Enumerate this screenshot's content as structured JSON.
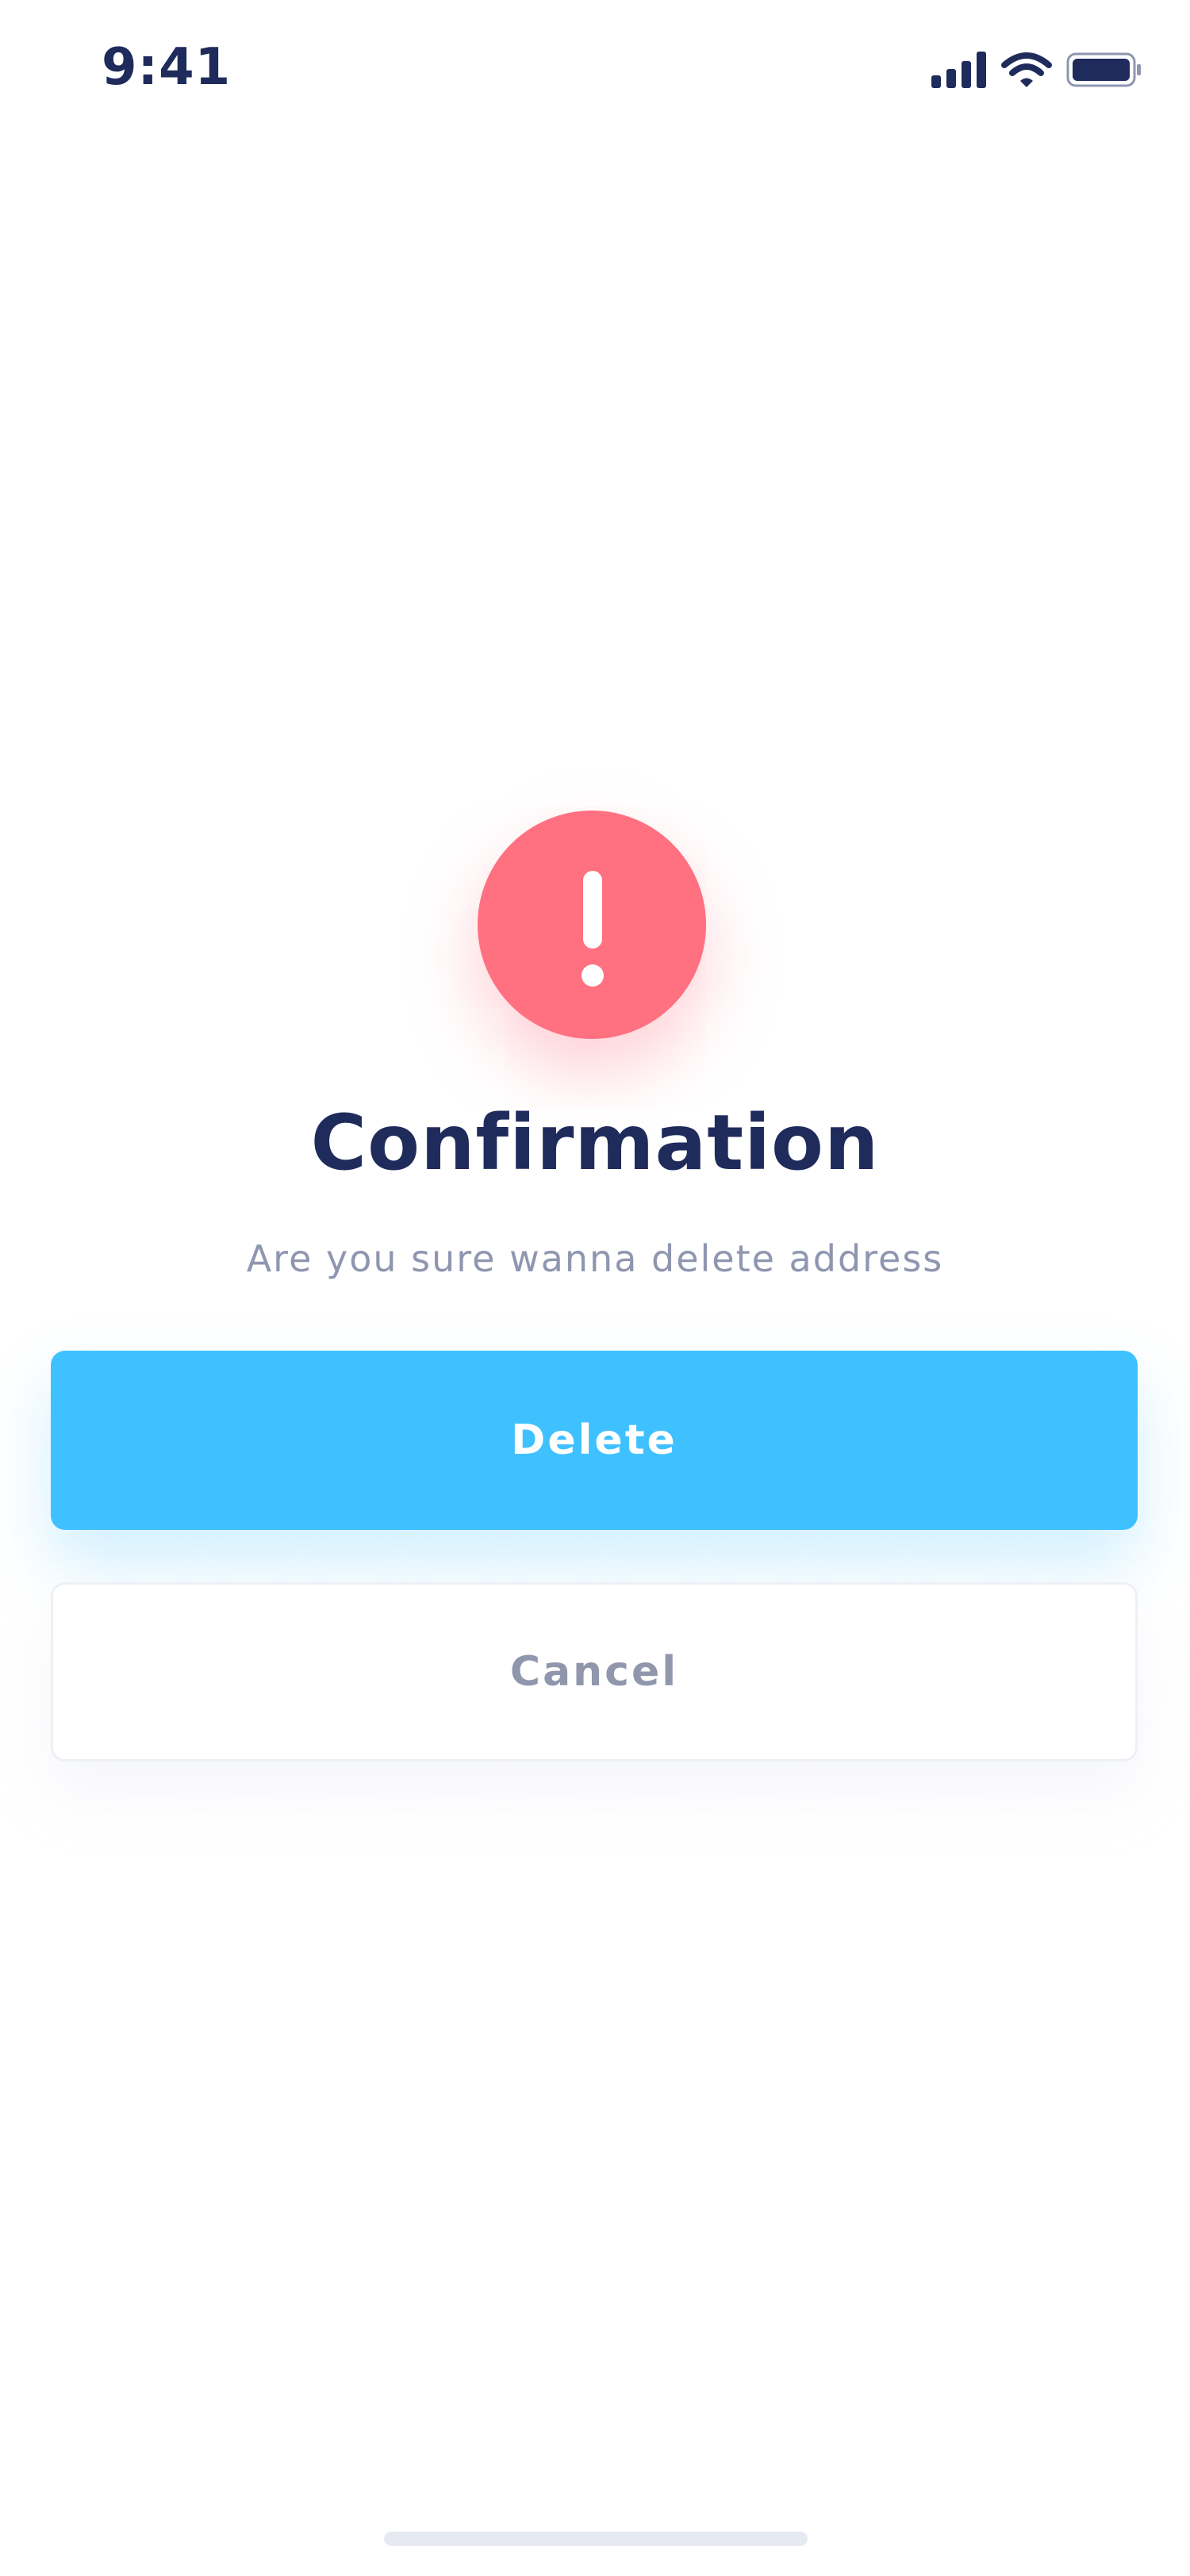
{
  "status_bar": {
    "time": "9:41",
    "icons": [
      "signal-icon",
      "wifi-icon",
      "battery-icon"
    ]
  },
  "dialog": {
    "icon": "exclamation-icon",
    "title": "Confirmation",
    "message": "Are you sure wanna delete address",
    "delete_label": "Delete",
    "cancel_label": "Cancel"
  },
  "colors": {
    "primary": "#40c1ff",
    "danger": "#ff7080",
    "title": "#1f2b5b",
    "muted": "#8f96b0"
  }
}
